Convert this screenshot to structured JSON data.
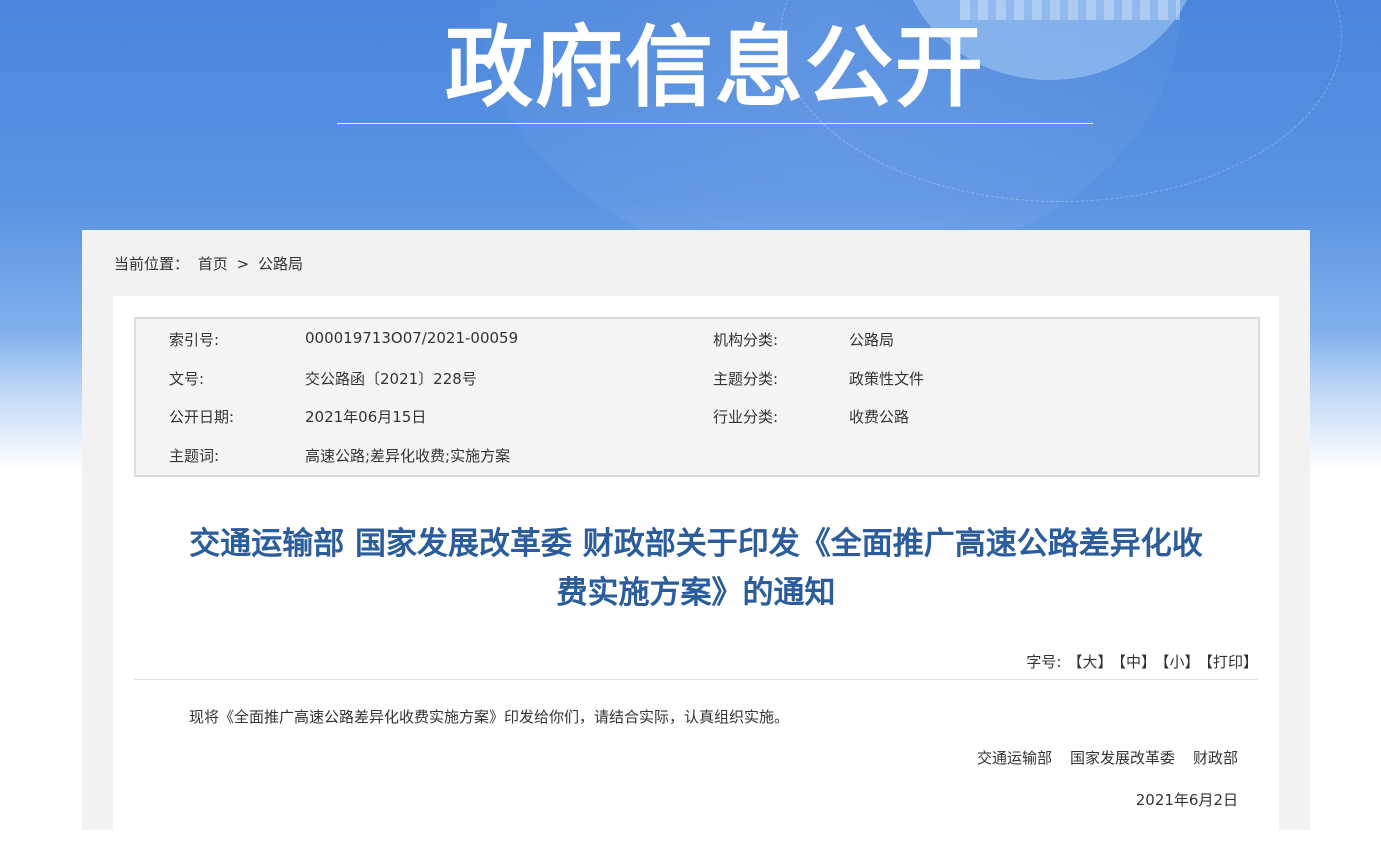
{
  "banner": {
    "title": "政府信息公开"
  },
  "breadcrumb": {
    "prefix": "当前位置：",
    "home": "首页",
    "sep": ">",
    "current": "公路局"
  },
  "meta": {
    "rows": [
      {
        "label": "索引号:",
        "value": "000019713O07/2021-00059",
        "label2": "机构分类:",
        "value2": "公路局"
      },
      {
        "label": "文号:",
        "value": "交公路函〔2021〕228号",
        "label2": "主题分类:",
        "value2": "政策性文件"
      },
      {
        "label": "公开日期:",
        "value": "2021年06月15日",
        "label2": "行业分类:",
        "value2": "收费公路"
      },
      {
        "label": "主题词:",
        "value": "高速公路;差异化收费;实施方案",
        "label2": "",
        "value2": ""
      }
    ]
  },
  "doc": {
    "title_line1": "交通运输部 国家发展改革委 财政部关于印发《全面推广高速公路差异化收",
    "title_line2": "费实施方案》的通知",
    "font_label": "字号:",
    "font_large": "【大】",
    "font_medium": "【中】",
    "font_small": "【小】",
    "print": "【打印】",
    "paragraph": "现将《全面推广高速公路差异化收费实施方案》印发给你们，请结合实际，认真组织实施。",
    "signers": [
      "交通运输部",
      "国家发展改革委",
      "财政部"
    ],
    "date": "2021年6月2日"
  },
  "colors": {
    "banner_blue": "#4a86dc",
    "title_blue": "#2b5d9c"
  }
}
